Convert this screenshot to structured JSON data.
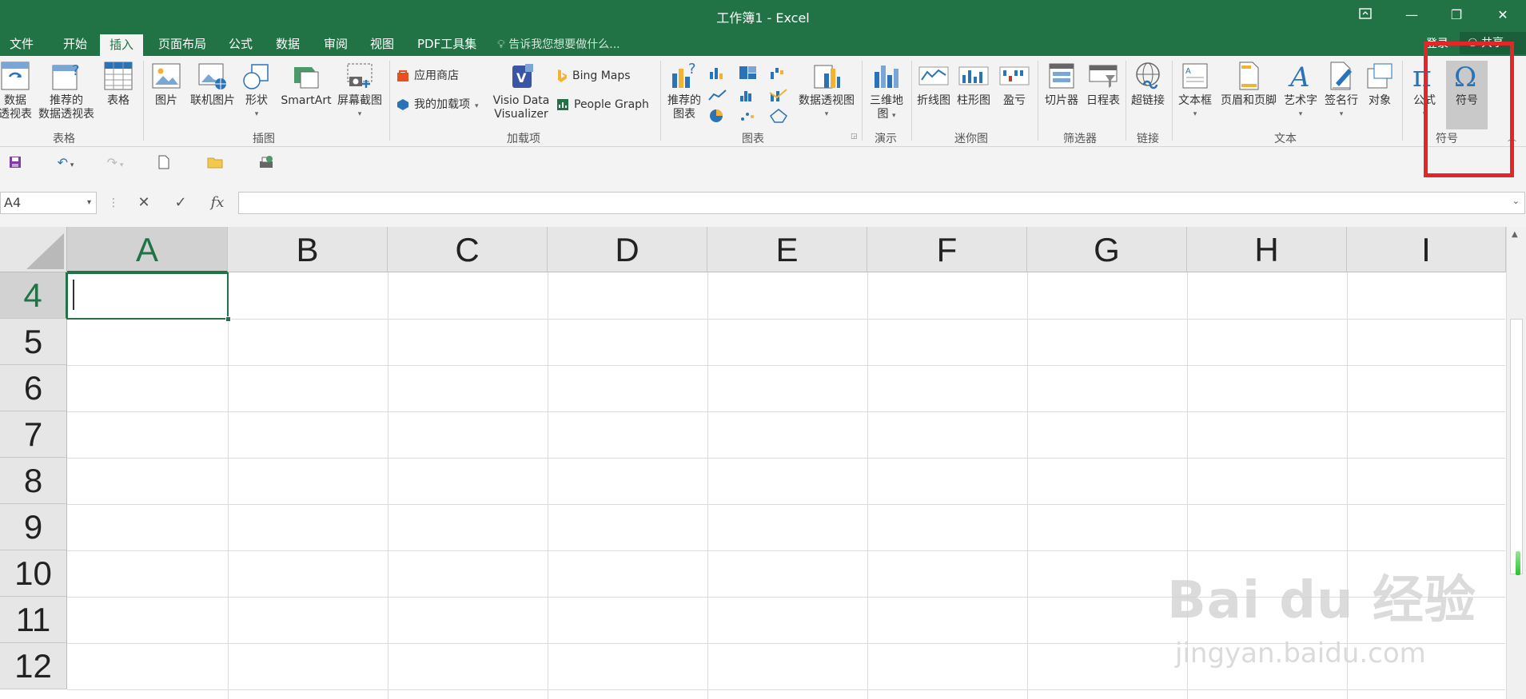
{
  "window": {
    "title": "工作簿1 - Excel",
    "restore_icon": "ribbon-display-icon",
    "minimize": "—",
    "maximize": "❐",
    "close": "✕"
  },
  "tabs": [
    {
      "label": "文件"
    },
    {
      "label": "开始"
    },
    {
      "label": "插入",
      "active": true
    },
    {
      "label": "页面布局"
    },
    {
      "label": "公式"
    },
    {
      "label": "数据"
    },
    {
      "label": "审阅"
    },
    {
      "label": "视图"
    },
    {
      "label": "PDF工具集"
    }
  ],
  "tellme": "告诉我您想要做什么...",
  "account": {
    "login": "登录",
    "share": "共享"
  },
  "ribbon": {
    "tables": {
      "pivot": "数据\n透视表",
      "recommended_pivot": "推荐的\n数据透视表",
      "table": "表格",
      "group": "表格"
    },
    "illustrations": {
      "pictures": "图片",
      "online_pictures": "联机图片",
      "shapes": "形状",
      "smartart": "SmartArt",
      "screenshot": "屏幕截图",
      "group": "插图"
    },
    "addins": {
      "store": "应用商店",
      "my_addins": "我的加载项",
      "visio": "Visio Data\nVisualizer",
      "bing_maps": "Bing Maps",
      "people_graph": "People Graph",
      "group": "加载项"
    },
    "charts": {
      "recommended": "推荐的\n图表",
      "pivot_chart": "数据透视图",
      "group": "图表"
    },
    "tours": {
      "map3d": "三维地\n图",
      "group": "演示"
    },
    "sparklines": {
      "line": "折线图",
      "column": "柱形图",
      "winloss": "盈亏",
      "group": "迷你图"
    },
    "filters": {
      "slicer": "切片器",
      "timeline": "日程表",
      "group": "筛选器"
    },
    "links": {
      "hyperlink": "超链接",
      "group": "链接"
    },
    "text": {
      "textbox": "文本框",
      "header_footer": "页眉和页脚",
      "wordart": "艺术字",
      "signature": "签名行",
      "object": "对象",
      "group": "文本"
    },
    "symbols": {
      "equation": "公式",
      "symbol": "符号",
      "group": "符号"
    }
  },
  "formula_bar": {
    "name_box": "A4",
    "cancel": "✕",
    "enter": "✓",
    "fx": "fx",
    "value": ""
  },
  "columns": [
    "A",
    "B",
    "C",
    "D",
    "E",
    "F",
    "G",
    "H",
    "I"
  ],
  "rows": [
    "4",
    "5",
    "6",
    "7",
    "8",
    "9",
    "10",
    "11",
    "12"
  ],
  "active_cell": "A4",
  "watermark": {
    "main": "Bai du 经验",
    "url": "jingyan.baidu.com"
  },
  "colors": {
    "excel_green": "#217346",
    "highlight_red": "#e3262a"
  }
}
